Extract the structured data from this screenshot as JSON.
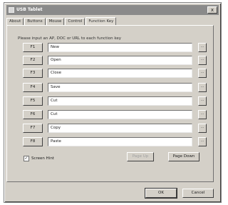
{
  "window": {
    "title": "USB Tablet",
    "close_glyph": "x"
  },
  "tabs": [
    {
      "label": "About"
    },
    {
      "label": "Buttons"
    },
    {
      "label": "Mouse"
    },
    {
      "label": "Control"
    },
    {
      "label": "Function Key",
      "selected": true
    }
  ],
  "function_keys": {
    "instruction": "Please input an AP, DOC or URL to each function key",
    "rows": [
      {
        "key": "F1",
        "value": "New"
      },
      {
        "key": "F2",
        "value": "Open"
      },
      {
        "key": "F3",
        "value": "Close"
      },
      {
        "key": "F4",
        "value": "Save"
      },
      {
        "key": "F5",
        "value": "Cut"
      },
      {
        "key": "F6",
        "value": "Cut"
      },
      {
        "key": "F7",
        "value": "Copy"
      },
      {
        "key": "F8",
        "value": "Paste"
      }
    ],
    "browse_label": "...",
    "screen_hint": {
      "label": "Screen Hint",
      "checked": true,
      "check_glyph": "✓"
    },
    "page_up_label": "Page Up",
    "page_down_label": "Page Down"
  },
  "footer": {
    "ok_label": "OK",
    "cancel_label": "Cancel"
  }
}
